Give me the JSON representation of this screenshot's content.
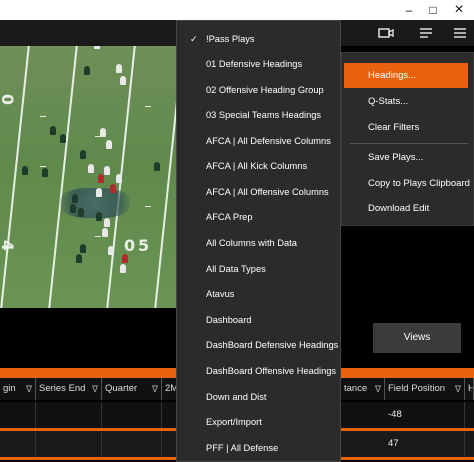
{
  "colors": {
    "accent": "#e8610f",
    "menu_bg": "#2b2b2b",
    "grid_bg": "#111111",
    "button_bg": "#3b3b3b"
  },
  "window_controls": {
    "close": "×",
    "minimize": "–",
    "maximize": "□"
  },
  "appbar": {
    "icons": [
      "camera-icon",
      "list-icon",
      "window-icon",
      "menu-icon"
    ]
  },
  "video": {
    "yard_numbers": [
      "0",
      "4",
      "0",
      "5"
    ]
  },
  "views_button": {
    "label": "Views"
  },
  "dropdown": {
    "items": [
      {
        "label": "!Pass Plays",
        "checked": true
      },
      {
        "label": "01 Defensive Headings",
        "checked": false
      },
      {
        "label": "02 Offensive Heading Group",
        "checked": false
      },
      {
        "label": "03 Special Teams Headings",
        "checked": false
      },
      {
        "label": "AFCA | All Defensive Columns",
        "checked": false
      },
      {
        "label": "AFCA | All Kick Columns",
        "checked": false
      },
      {
        "label": "AFCA | All Offensive Columns",
        "checked": false
      },
      {
        "label": "AFCA Prep",
        "checked": false
      },
      {
        "label": "All Columns with Data",
        "checked": false
      },
      {
        "label": "All Data Types",
        "checked": false
      },
      {
        "label": "Atavus",
        "checked": false
      },
      {
        "label": "Dashboard",
        "checked": false
      },
      {
        "label": "DashBoard Defensive Headings",
        "checked": false
      },
      {
        "label": "DashBoard Offensive Headings",
        "checked": false
      },
      {
        "label": "Down and Dist",
        "checked": false
      },
      {
        "label": "Export/Import",
        "checked": false
      },
      {
        "label": "PFF | All Defense",
        "checked": false
      }
    ],
    "check_glyph": "✓"
  },
  "context_menu": {
    "items": [
      {
        "label": "Headings...",
        "active": true
      },
      {
        "label": "Q-Stats...",
        "active": false
      },
      {
        "label": "Clear Filters",
        "active": false
      },
      {
        "label": "Save Plays...",
        "active": false
      },
      {
        "label": "Copy to Plays Clipboard",
        "active": false
      },
      {
        "label": "Download Edit",
        "active": false
      }
    ]
  },
  "grid": {
    "columns": [
      "gin",
      "Series End",
      "Quarter",
      "2M",
      "tance",
      "Field Position",
      "H"
    ],
    "filter_glyph": "∇",
    "rows": [
      {
        "field_position": "-48"
      },
      {
        "field_position": "47"
      },
      {
        "field_position": ""
      }
    ]
  }
}
